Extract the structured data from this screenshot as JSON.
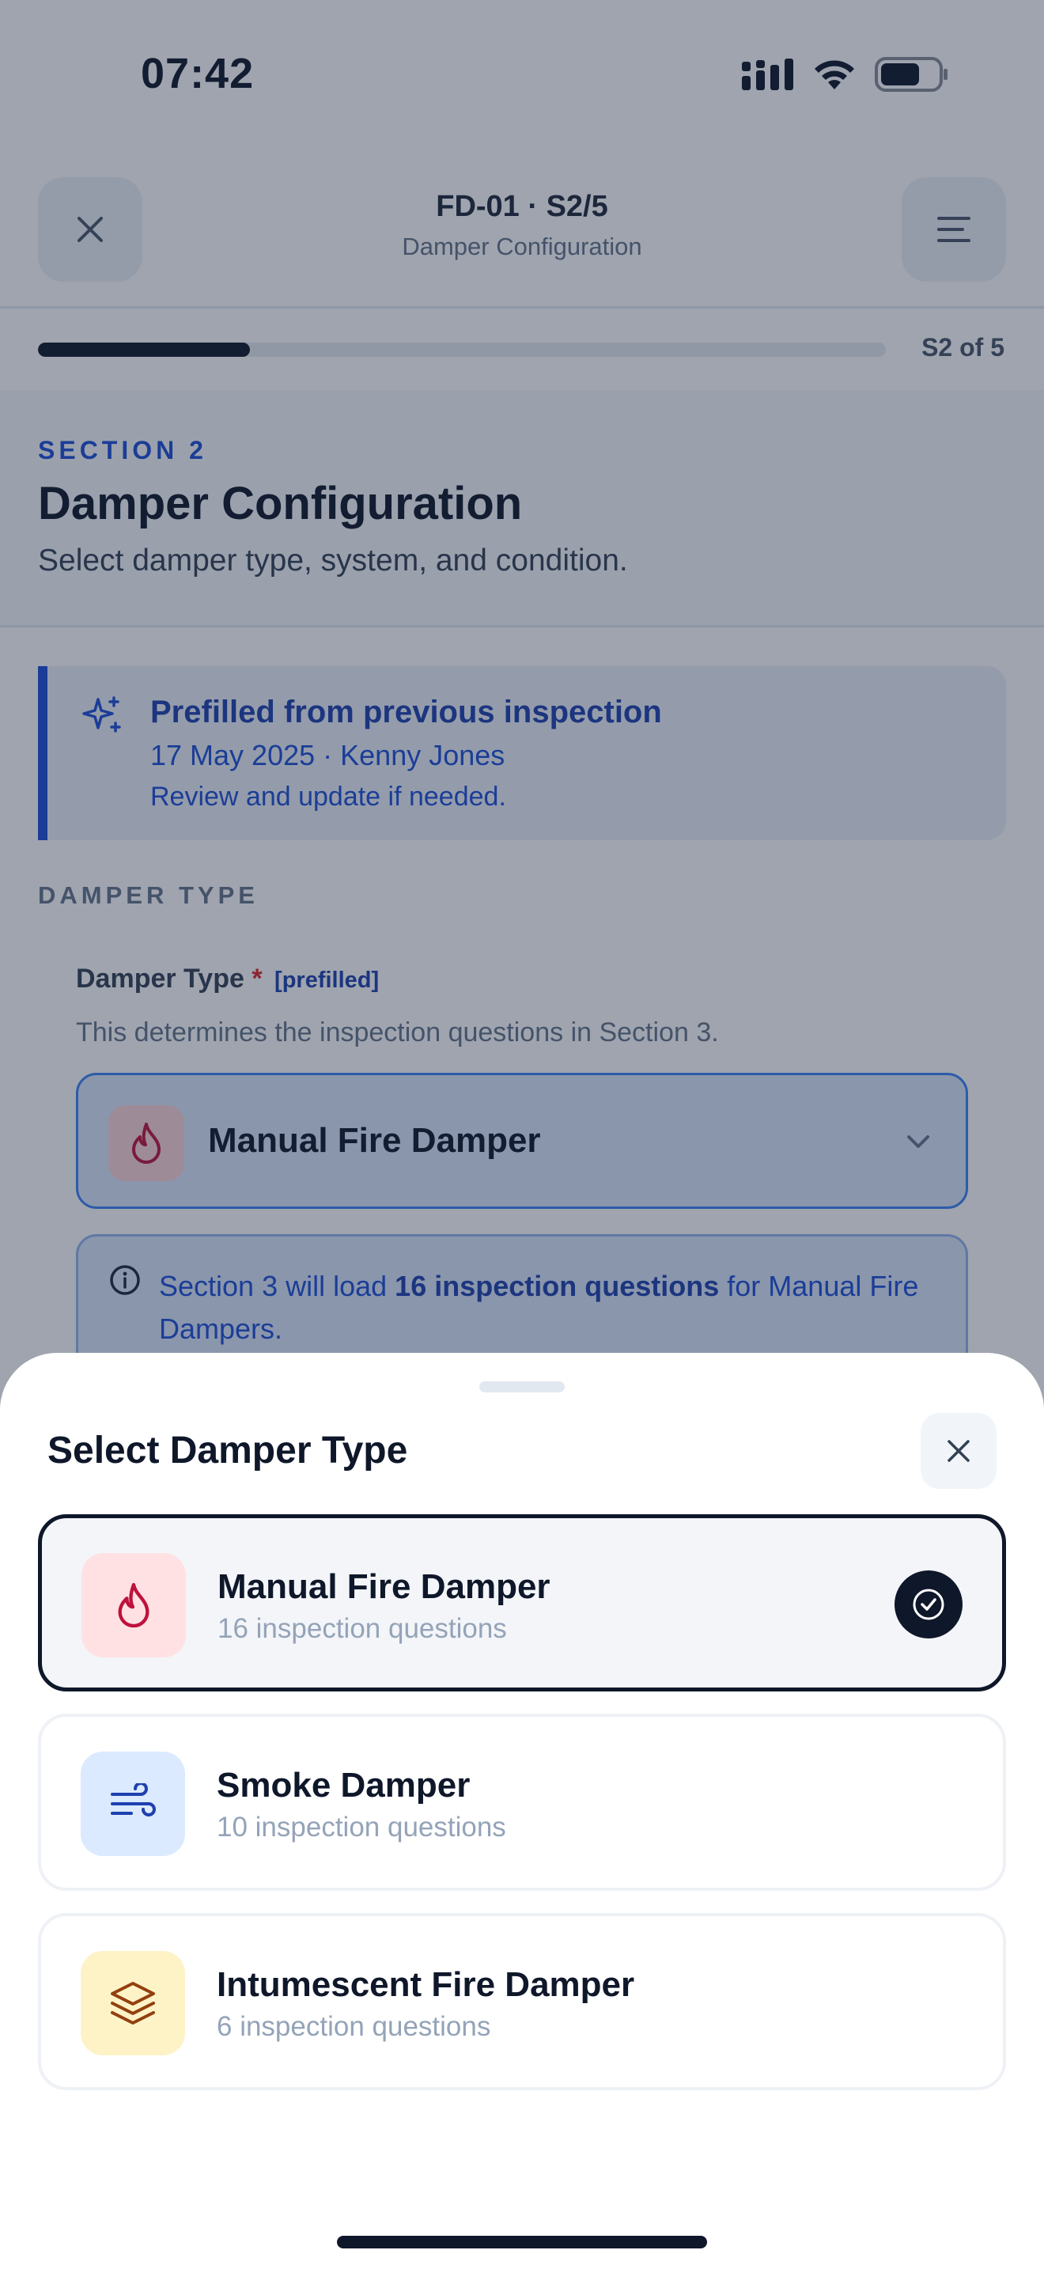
{
  "status_bar": {
    "time": "07:42",
    "icons": [
      "signal-icon",
      "wifi-icon",
      "battery-icon"
    ]
  },
  "nav": {
    "title": "FD-01 · S2/5",
    "subtitle": "Damper Configuration",
    "left_icon": "close-icon",
    "right_icon": "menu-icon"
  },
  "progress": {
    "fraction": 0.25,
    "label": "S2 of 5"
  },
  "section": {
    "kicker": "SECTION 2",
    "title": "Damper Configuration",
    "description": "Select damper type, system, and condition."
  },
  "prefill_banner": {
    "icon": "sparkles-icon",
    "title": "Prefilled from previous inspection",
    "meta": "17 May 2025 · Kenny Jones",
    "note": "Review and update if needed."
  },
  "damper_type_group": {
    "label": "DAMPER TYPE",
    "field_label": "Damper Type",
    "required_mark": "*",
    "prefilled_tag": "[prefilled]",
    "help": "This determines the inspection questions in Section 3.",
    "selected_value": "Manual Fire Damper",
    "info_prefix": "Section 3 will load ",
    "info_bold": "16 inspection questions",
    "info_suffix": " for Manual Fire Dampers."
  },
  "sheet": {
    "title": "Select Damper Type",
    "close_icon": "close-icon",
    "options": [
      {
        "title": "Manual Fire Damper",
        "subtitle": "16 inspection questions",
        "icon": "flame-icon",
        "selected": true
      },
      {
        "title": "Smoke Damper",
        "subtitle": "10 inspection questions",
        "icon": "wind-icon",
        "selected": false
      },
      {
        "title": "Intumescent Fire Damper",
        "subtitle": "6 inspection questions",
        "icon": "layers-icon",
        "selected": false
      }
    ]
  },
  "colors": {
    "primary": "#0f172a",
    "accent_blue": "#1d4ed8",
    "fire_bg": "#ffe1e4",
    "fire_fg": "#be123c",
    "smoke_bg": "#dbeafe",
    "smoke_fg": "#1e40af",
    "intumescent_bg": "#fef3c7",
    "intumescent_fg": "#92400e"
  }
}
